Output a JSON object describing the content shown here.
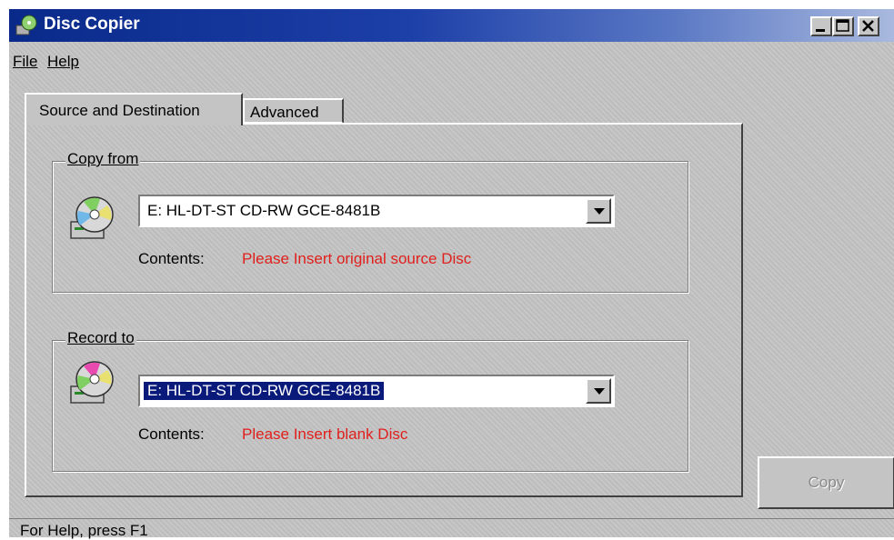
{
  "window": {
    "title": "Disc Copier",
    "controls": [
      "minimize",
      "maximize",
      "close"
    ]
  },
  "menu": {
    "file": "File",
    "help": "Help"
  },
  "tabs": [
    {
      "label": "Source and Destination",
      "active": true
    },
    {
      "label": "Advanced",
      "active": false
    }
  ],
  "copy_from": {
    "group_label": "Copy from",
    "drive": "E: HL-DT-ST CD-RW GCE-8481B",
    "contents_label": "Contents:",
    "contents_value": "Please Insert original source Disc"
  },
  "record_to": {
    "group_label": "Record to",
    "drive": "E: HL-DT-ST CD-RW GCE-8481B",
    "contents_label": "Contents:",
    "contents_value": "Please Insert blank Disc"
  },
  "buttons": {
    "copy": "Copy",
    "copy_enabled": false
  },
  "status": {
    "text": "For Help, press F1"
  },
  "colors": {
    "title_gradient_start": "#0a2a8a",
    "title_gradient_end": "#a9b9de",
    "face": "#c4c4c4",
    "warning_text": "#e0201c",
    "selection": "#0a1a7a"
  },
  "icons": {
    "app": "disc-copier-icon",
    "drive": "cd-drive-icon",
    "dropdown": "chevron-down-icon"
  }
}
